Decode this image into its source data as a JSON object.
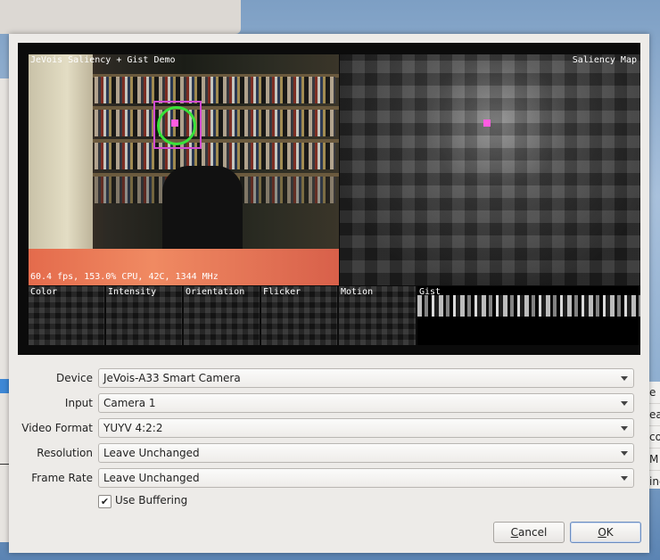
{
  "preview": {
    "title_overlay": "JeVois Saliency + Gist Demo",
    "saliency_title": "Saliency Map",
    "stats": "60.4 fps, 153.0% CPU, 42C, 1344 MHz",
    "channels": [
      "Color",
      "Intensity",
      "Orientation",
      "Flicker",
      "Motion",
      "Gist"
    ],
    "highlight_color": "#d14bd1",
    "ring_color": "#39e23a",
    "salient_dot_color": "#ff5ce1"
  },
  "form": {
    "device_label": "Device",
    "device_value": "JeVois-A33 Smart Camera",
    "input_label": "Input",
    "input_value": "Camera 1",
    "video_format_label": "Video Format",
    "video_format_value": "YUYV 4:2:2",
    "resolution_label": "Resolution",
    "resolution_value": "Leave Unchanged",
    "frame_rate_label": "Frame Rate",
    "frame_rate_value": "Leave Unchanged",
    "use_buffering_label": "Use Buffering",
    "use_buffering_checked": "✔"
  },
  "buttons": {
    "cancel_mnemonic": "C",
    "cancel_rest": "ancel",
    "ok_mnemonic": "O",
    "ok_rest": "K"
  },
  "background_window": {
    "right_fragments": [
      "e",
      "ea",
      "co",
      "M",
      "ing",
      "it"
    ]
  }
}
